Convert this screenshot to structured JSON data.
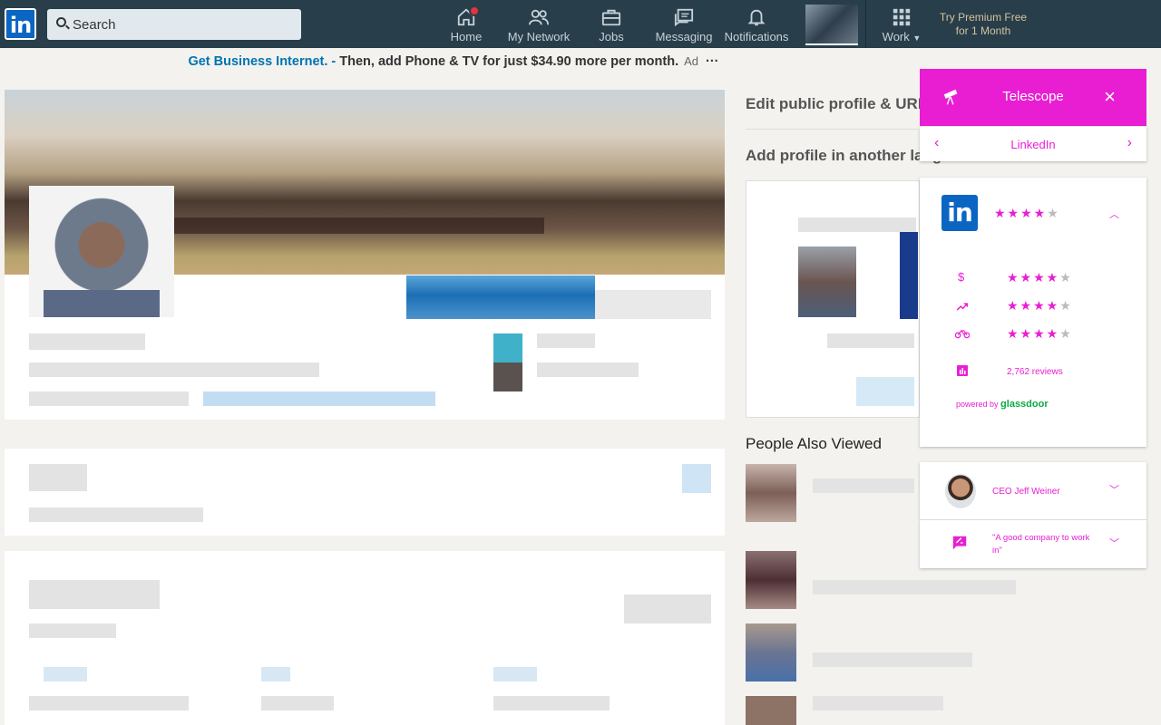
{
  "topbar": {
    "search_placeholder": "Search",
    "nav": [
      {
        "label": "Home",
        "icon": "home-icon"
      },
      {
        "label": "My Network",
        "icon": "network-icon"
      },
      {
        "label": "Jobs",
        "icon": "briefcase-icon"
      },
      {
        "label": "Messaging",
        "icon": "messaging-icon"
      },
      {
        "label": "Notifications",
        "icon": "bell-icon"
      }
    ],
    "work_label": "Work",
    "premium_line1": "Try Premium Free",
    "premium_line2": "for 1 Month"
  },
  "ad": {
    "link_text": "Get Business Internet. -",
    "text": " Then, add Phone & TV for just $34.90 more per month.",
    "tag": "Ad",
    "more": "···"
  },
  "sidebar": {
    "edit_profile": "Edit public profile & URL",
    "add_language": "Add profile in another lang",
    "people_also_viewed": "People Also Viewed"
  },
  "telescope": {
    "title": "Telescope",
    "close": "×",
    "company": "LinkedIn",
    "overall_rating": 4.5,
    "ratings": [
      {
        "icon": "dollar-icon",
        "value": 4.5
      },
      {
        "icon": "trending-up-icon",
        "value": 4
      },
      {
        "icon": "bike-icon",
        "value": 4
      }
    ],
    "reviews": "2,762 reviews",
    "powered_by": "powered by",
    "brand": "glassdoor",
    "ceo": "CEO Jeff Weiner",
    "review_quote": "\"A good company to work in\""
  },
  "colors": {
    "topbar": "#283e4a",
    "accent": "#e91ed3",
    "linkedin_blue": "#0a66c2",
    "glassdoor_green": "#0caa41"
  }
}
